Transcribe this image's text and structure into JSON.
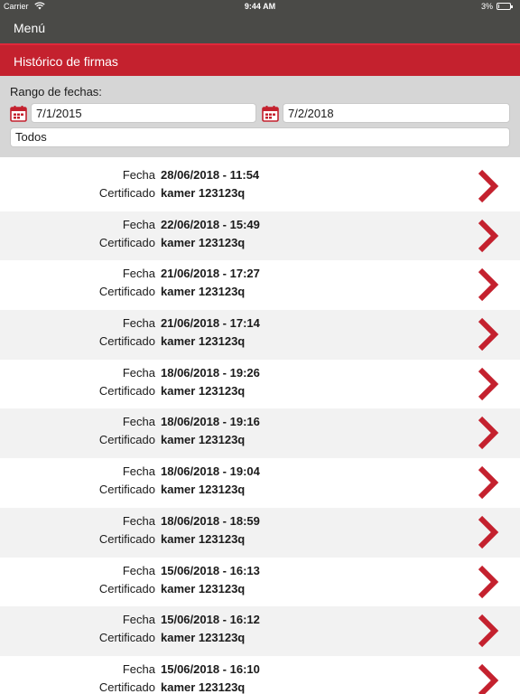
{
  "status_bar": {
    "carrier": "Carrier",
    "time": "9:44 AM",
    "battery": "3%",
    "wifi_icon": "wifi-icon",
    "battery_icon": "battery-icon"
  },
  "nav": {
    "menu_label": "Menú"
  },
  "header": {
    "title": "Histórico de firmas"
  },
  "filters": {
    "range_label": "Rango de fechas:",
    "date_from": "7/1/2015",
    "date_to": "7/2/2018",
    "certificate_select": "Todos",
    "calendar_icon": "calendar-icon"
  },
  "colors": {
    "nav_background": "#4a4a47",
    "accent_red": "#c4212e",
    "filter_background": "#d6d6d6",
    "row_alt": "#f2f2f2"
  },
  "list": {
    "fecha_label": "Fecha",
    "certificado_label": "Certificado",
    "row_icon": "chevron-right-icon",
    "rows": [
      {
        "fecha": "28/06/2018 - 11:54",
        "certificado": "kamer 123123q"
      },
      {
        "fecha": "22/06/2018 - 15:49",
        "certificado": "kamer 123123q"
      },
      {
        "fecha": "21/06/2018 - 17:27",
        "certificado": "kamer 123123q"
      },
      {
        "fecha": "21/06/2018 - 17:14",
        "certificado": "kamer 123123q"
      },
      {
        "fecha": "18/06/2018 - 19:26",
        "certificado": "kamer 123123q"
      },
      {
        "fecha": "18/06/2018 - 19:16",
        "certificado": "kamer 123123q"
      },
      {
        "fecha": "18/06/2018 - 19:04",
        "certificado": "kamer 123123q"
      },
      {
        "fecha": "18/06/2018 - 18:59",
        "certificado": "kamer 123123q"
      },
      {
        "fecha": "15/06/2018 - 16:13",
        "certificado": "kamer 123123q"
      },
      {
        "fecha": "15/06/2018 - 16:12",
        "certificado": "kamer 123123q"
      },
      {
        "fecha": "15/06/2018 - 16:10",
        "certificado": "kamer 123123q"
      }
    ]
  }
}
